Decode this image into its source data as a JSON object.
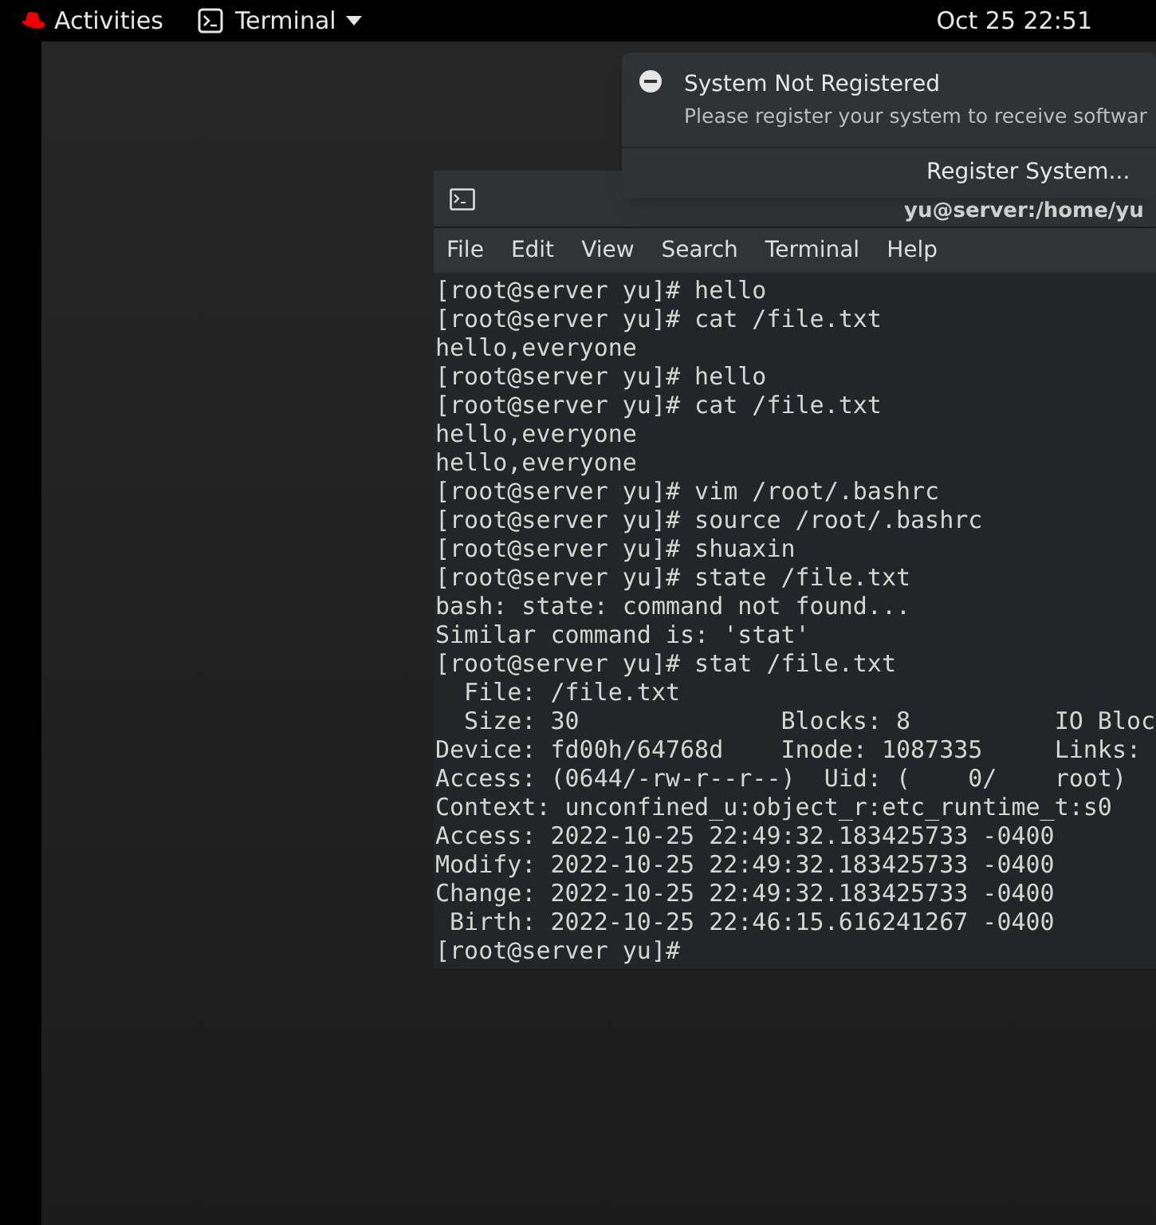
{
  "top_bar": {
    "activities": "Activities",
    "app_menu": "Terminal",
    "clock": "Oct 25  22:51"
  },
  "notification": {
    "title": "System Not Registered",
    "body": "Please register your system to receive softwar",
    "action": "Register System..."
  },
  "terminal": {
    "title": "yu@server:/home/yu",
    "menu": [
      "File",
      "Edit",
      "View",
      "Search",
      "Terminal",
      "Help"
    ],
    "lines": [
      "[root@server yu]# hello",
      "[root@server yu]# cat /file.txt",
      "hello,everyone",
      "[root@server yu]# hello",
      "[root@server yu]# cat /file.txt",
      "hello,everyone",
      "hello,everyone",
      "[root@server yu]# vim /root/.bashrc",
      "[root@server yu]# source /root/.bashrc",
      "[root@server yu]# shuaxin",
      "[root@server yu]# state /file.txt",
      "bash: state: command not found...",
      "Similar command is: 'stat'",
      "[root@server yu]# stat /file.txt",
      "  File: /file.txt",
      "  Size: 30              Blocks: 8          IO Bloc",
      "Device: fd00h/64768d    Inode: 1087335     Links:",
      "Access: (0644/-rw-r--r--)  Uid: (    0/    root)",
      "Context: unconfined_u:object_r:etc_runtime_t:s0",
      "Access: 2022-10-25 22:49:32.183425733 -0400",
      "Modify: 2022-10-25 22:49:32.183425733 -0400",
      "Change: 2022-10-25 22:49:32.183425733 -0400",
      " Birth: 2022-10-25 22:46:15.616241267 -0400",
      "[root@server yu]#"
    ]
  }
}
